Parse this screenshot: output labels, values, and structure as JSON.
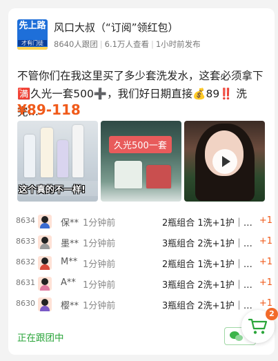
{
  "account": {
    "avatar_text_top": "先上路",
    "avatar_text_bottom": "才有门徒",
    "name": "风口大叔（“订阅”领红包）",
    "followers": "8640人跟团",
    "views": "6.1万人查看",
    "posted": "1小时前发布"
  },
  "post": {
    "description": "不管你们在我这里买了多少套洗发水，这套必须拿下🈵久光一套500➕，我们好日期直接💰89‼️ 洗完…",
    "price": "¥89-118"
  },
  "images": [
    {
      "caption": "这个真的不一样!"
    },
    {
      "caption": "久光500一套"
    },
    {
      "caption": ""
    }
  ],
  "orders": [
    {
      "num": "8634",
      "user": "保**",
      "time": "1分钟前",
      "item": "2瓶组合 1洗+1护｜…",
      "qty": "+1"
    },
    {
      "num": "8633",
      "user": "墨**",
      "time": "1分钟前",
      "item": "3瓶组合 2洗+1护｜…",
      "qty": "+1"
    },
    {
      "num": "8632",
      "user": "M**",
      "time": "1分钟前",
      "item": "2瓶组合 1洗+1护｜…",
      "qty": "+1"
    },
    {
      "num": "8631",
      "user": "A**",
      "time": "1分钟前",
      "item": "3瓶组合 2洗+1护｜…",
      "qty": "+1"
    },
    {
      "num": "8630",
      "user": "樱**",
      "time": "1分钟前",
      "item": "3瓶组合 2洗+1护｜…",
      "qty": "+1"
    }
  ],
  "footer": {
    "following_label": "正在跟团中",
    "cart_count": "2"
  },
  "colors": {
    "accent": "#f05a1a",
    "green": "#2aa53a",
    "brand_blue": "#1e6fd9"
  }
}
